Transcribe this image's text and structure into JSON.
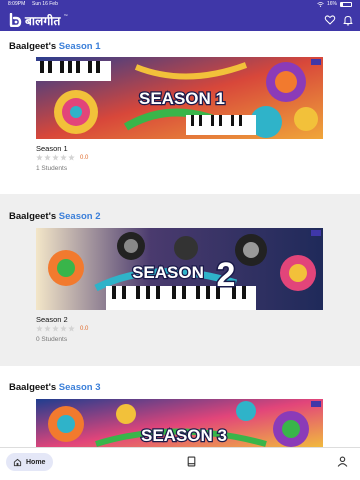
{
  "status_bar": {
    "time": "8:09PM",
    "date": "Sun 16 Feb",
    "battery": "16%"
  },
  "app": {
    "logo_text": "बालगीत",
    "logo_tm": "™",
    "icons": [
      "heart-icon",
      "bell-icon"
    ],
    "header_color": "#3f37a8"
  },
  "sections": [
    {
      "prefix": "Baalgeet's ",
      "season": "Season 1",
      "banner_text": "SEASON 1",
      "course_name": "Season 1",
      "rating_value": "0.0",
      "rating_stars": 0,
      "students": "1 Students"
    },
    {
      "prefix": "Baalgeet's ",
      "season": "Season 2",
      "banner_text_a": "SEASON",
      "banner_text_b": "2",
      "course_name": "Season 2",
      "rating_value": "0.0",
      "rating_stars": 0,
      "students": "0 Students"
    },
    {
      "prefix": "Baalgeet's ",
      "season": "Season 3",
      "banner_text": "SEASON 3"
    }
  ],
  "bottom_nav": {
    "home_label": "Home",
    "icons": [
      "home-icon",
      "book-icon",
      "profile-icon"
    ]
  },
  "colors": {
    "accent": "#3b7fd9",
    "rating": "#e06b2c",
    "section_gray": "#efefef"
  }
}
